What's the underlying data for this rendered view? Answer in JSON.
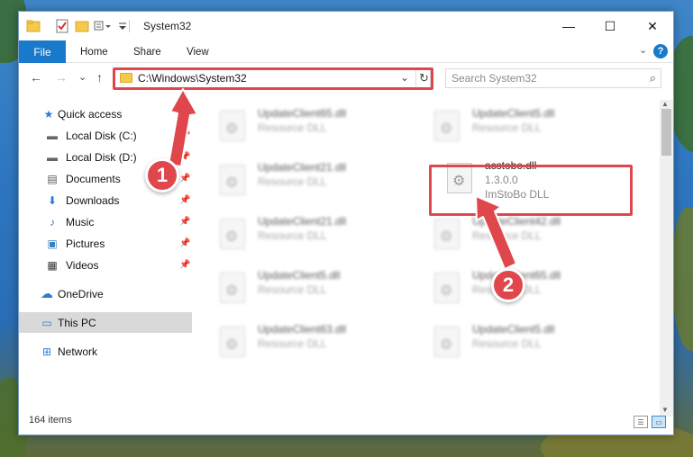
{
  "window": {
    "title": "System32",
    "controls": {
      "minimize": "—",
      "maximize": "☐",
      "close": "✕"
    }
  },
  "ribbon": {
    "tabs": [
      {
        "label": "File"
      },
      {
        "label": "Home"
      },
      {
        "label": "Share"
      },
      {
        "label": "View"
      }
    ],
    "expand": "⌄",
    "help": "?"
  },
  "nav": {
    "back": "←",
    "forward": "→",
    "recent": "⌄",
    "up": "↑",
    "address": "C:\\Windows\\System32",
    "address_chevron": "⌄",
    "refresh": "↻",
    "search_placeholder": "Search System32",
    "search_icon": "⌕"
  },
  "sidebar": {
    "items": [
      {
        "label": "Quick access",
        "icon": "star-icon",
        "glyph": "★",
        "pinned": false
      },
      {
        "label": "Local Disk (C:)",
        "icon": "drive-icon",
        "glyph": "▬",
        "pinned": true
      },
      {
        "label": "Local Disk (D:)",
        "icon": "drive-icon",
        "glyph": "▬",
        "pinned": true
      },
      {
        "label": "Documents",
        "icon": "documents-icon",
        "glyph": "▤",
        "pinned": true
      },
      {
        "label": "Downloads",
        "icon": "downloads-icon",
        "glyph": "⬇",
        "pinned": true
      },
      {
        "label": "Music",
        "icon": "music-icon",
        "glyph": "♪",
        "pinned": true
      },
      {
        "label": "Pictures",
        "icon": "pictures-icon",
        "glyph": "▣",
        "pinned": true
      },
      {
        "label": "Videos",
        "icon": "videos-icon",
        "glyph": "▦",
        "pinned": true
      },
      {
        "label": "OneDrive",
        "icon": "cloud-icon",
        "glyph": "☁",
        "pinned": false
      },
      {
        "label": "This PC",
        "icon": "computer-icon",
        "glyph": "▭",
        "pinned": false,
        "selected": true
      },
      {
        "label": "Network",
        "icon": "network-icon",
        "glyph": "⊞",
        "pinned": false
      }
    ],
    "pin_glyph": "📌"
  },
  "files": {
    "left": [
      {
        "name": "UpdateClient65.dll",
        "desc": "Resource DLL"
      },
      {
        "name": "UpdateClient21.dll",
        "desc": "Resource DLL"
      },
      {
        "name": "UpdateClient21.dll",
        "desc": "Resource DLL"
      },
      {
        "name": "UpdateClient5.dll",
        "desc": "Resource DLL"
      },
      {
        "name": "UpdateClient63.dll",
        "desc": "Resource DLL"
      }
    ],
    "right": [
      {
        "name": "UpdateClient5.dll",
        "desc": "Resource DLL"
      },
      {
        "name": "acstobo.dll",
        "version": "1.3.0.0",
        "desc": "ImStoBo DLL",
        "highlight": true
      },
      {
        "name": "UpdateClient42.dll",
        "desc": "Resource DLL"
      },
      {
        "name": "UpdateClient65.dll",
        "desc": "Resource DLL"
      },
      {
        "name": "UpdateClient5.dll",
        "desc": "Resource DLL"
      }
    ]
  },
  "status": {
    "item_count": "164 items"
  },
  "callouts": [
    {
      "label": "1"
    },
    {
      "label": "2"
    }
  ],
  "colors": {
    "accent": "#1979ca",
    "highlight": "#e0474c",
    "selected": "#d9d9d9"
  }
}
